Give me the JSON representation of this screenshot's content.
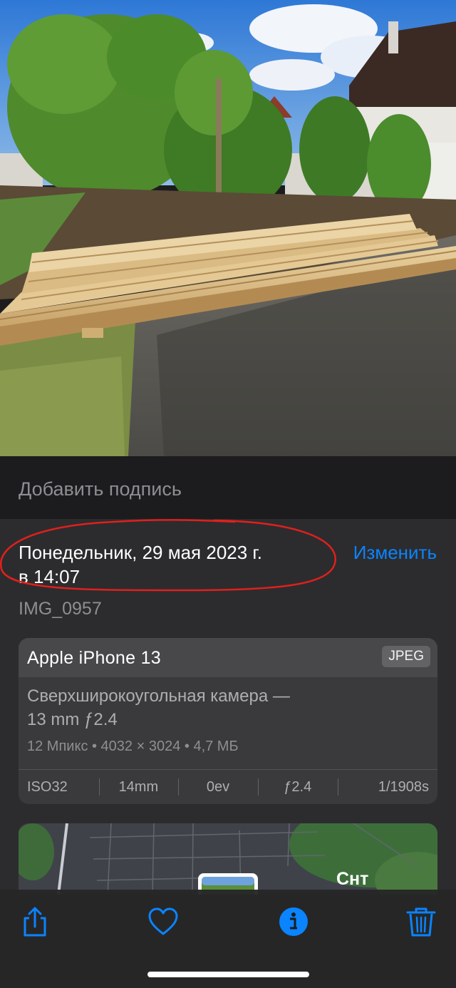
{
  "caption": {
    "placeholder": "Добавить подпись"
  },
  "datetime": {
    "line1": "Понедельник, 29 мая 2023 г.",
    "line2": "в 14:07",
    "edit_label": "Изменить"
  },
  "file": {
    "name": "IMG_0957"
  },
  "metadata": {
    "device": "Apple iPhone 13",
    "format": "JPEG",
    "lens_line1": "Сверхширокоугольная камера —",
    "lens_line2": "13 mm ƒ2.4",
    "specs": "12 Мпикс  •  4032 × 3024  •  4,7 МБ",
    "exif": [
      "ISO32",
      "14mm",
      "0ev",
      "ƒ2.4",
      "1/1908s"
    ]
  },
  "map": {
    "label": "Снт"
  },
  "toolbar": {
    "share_icon": "share-icon",
    "like_icon": "heart-icon",
    "info_icon": "info-icon",
    "delete_icon": "trash-icon"
  },
  "colors": {
    "accent": "#0a84ff",
    "annotation": "#e0201c",
    "background": "#1c1c1e",
    "panel": "#2c2c2e"
  }
}
